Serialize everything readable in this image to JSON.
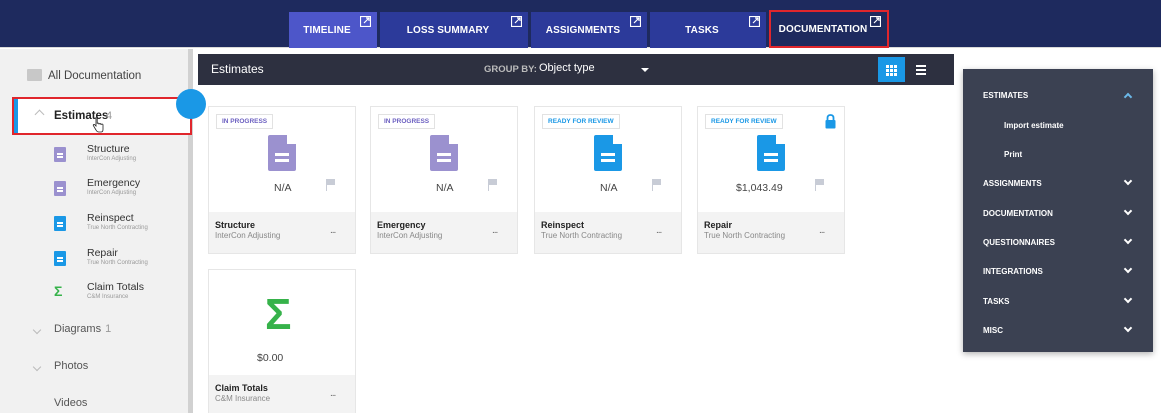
{
  "tabs": [
    {
      "label": "TIMELINE"
    },
    {
      "label": "LOSS SUMMARY"
    },
    {
      "label": "ASSIGNMENTS"
    },
    {
      "label": "TASKS"
    },
    {
      "label": "DOCUMENTATION"
    }
  ],
  "sidebar": {
    "all_label": "All Documentation",
    "estimates": {
      "label": "Estimates",
      "count": "4"
    },
    "sub_items": [
      {
        "name": "Structure",
        "company": "InterCon Adjusting"
      },
      {
        "name": "Emergency",
        "company": "InterCon Adjusting"
      },
      {
        "name": "Reinspect",
        "company": "True North Contracting"
      },
      {
        "name": "Repair",
        "company": "True North Contracting"
      },
      {
        "name": "Claim Totals",
        "company": "C&M Insurance"
      }
    ],
    "diagrams": {
      "label": "Diagrams",
      "count": "1"
    },
    "photos": {
      "label": "Photos"
    },
    "videos": {
      "label": "Videos"
    }
  },
  "header": {
    "title": "Estimates",
    "group_by_label": "GROUP BY:",
    "group_by_value": "Object type"
  },
  "cards": [
    {
      "status": "IN PROGRESS",
      "value": "N/A",
      "name": "Structure",
      "company": "InterCon Adjusting",
      "more": "..."
    },
    {
      "status": "IN PROGRESS",
      "value": "N/A",
      "name": "Emergency",
      "company": "InterCon Adjusting",
      "more": "..."
    },
    {
      "status": "READY FOR REVIEW",
      "value": "N/A",
      "name": "Reinspect",
      "company": "True North Contracting",
      "more": "..."
    },
    {
      "status": "READY FOR REVIEW",
      "value": "$1,043.49",
      "name": "Repair",
      "company": "True North Contracting",
      "more": "..."
    },
    {
      "value": "$0.00",
      "name": "Claim Totals",
      "company": "C&M Insurance",
      "more": "..."
    }
  ],
  "menu": {
    "sections": [
      {
        "label": "ESTIMATES"
      },
      {
        "label": "ASSIGNMENTS"
      },
      {
        "label": "DOCUMENTATION"
      },
      {
        "label": "QUESTIONNAIRES"
      },
      {
        "label": "INTEGRATIONS"
      },
      {
        "label": "TASKS"
      },
      {
        "label": "MISC"
      }
    ],
    "estimate_actions": [
      {
        "label": "Import estimate"
      },
      {
        "label": "Print"
      }
    ]
  },
  "colors": {
    "nav_bg": "#1e2a5e",
    "accent_blue": "#1a98e6",
    "in_progress_purple": "#9b91cf",
    "totals_green": "#36b24a",
    "highlight_red": "#e0262c",
    "menu_bg": "#3b4152"
  }
}
